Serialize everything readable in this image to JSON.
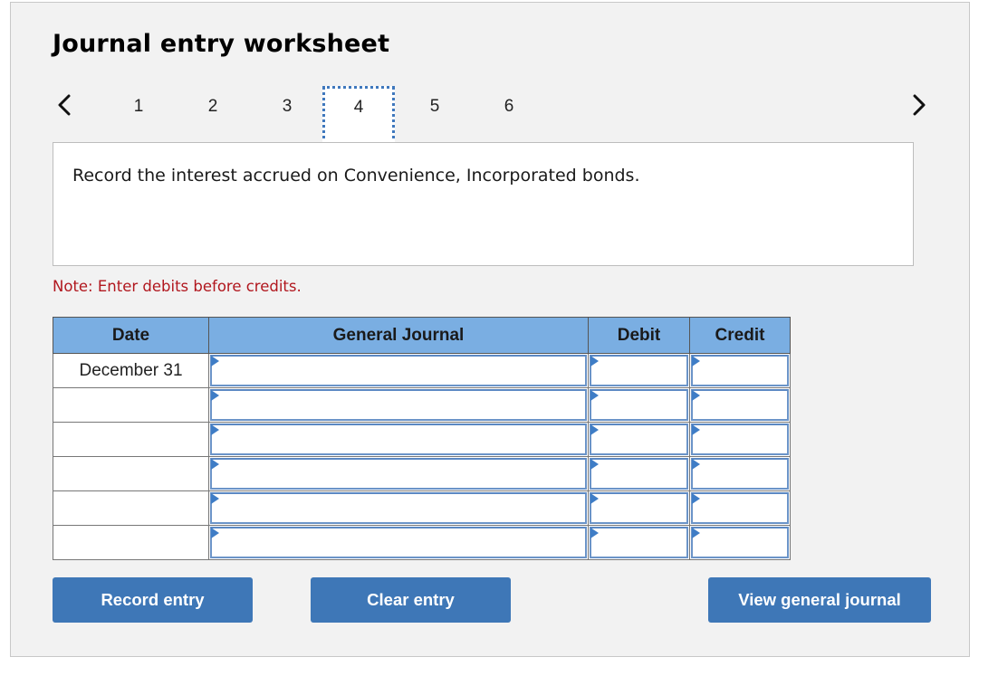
{
  "worksheet": {
    "title": "Journal entry worksheet",
    "nav": {
      "prev_icon": "chevron-left-icon",
      "next_icon": "chevron-right-icon",
      "steps": [
        "1",
        "2",
        "3",
        "4",
        "5",
        "6"
      ],
      "active_step": "4"
    },
    "prompt": "Record the interest accrued on Convenience, Incorporated bonds.",
    "note": "Note: Enter debits before credits.",
    "table": {
      "headers": {
        "date": "Date",
        "general_journal": "General Journal",
        "debit": "Debit",
        "credit": "Credit"
      },
      "rows": [
        {
          "date": "December 31",
          "account": "",
          "debit": "",
          "credit": ""
        },
        {
          "date": "",
          "account": "",
          "debit": "",
          "credit": ""
        },
        {
          "date": "",
          "account": "",
          "debit": "",
          "credit": ""
        },
        {
          "date": "",
          "account": "",
          "debit": "",
          "credit": ""
        },
        {
          "date": "",
          "account": "",
          "debit": "",
          "credit": ""
        },
        {
          "date": "",
          "account": "",
          "debit": "",
          "credit": ""
        }
      ]
    },
    "buttons": {
      "record": "Record entry",
      "clear": "Clear entry",
      "view": "View general journal"
    },
    "colors": {
      "header_bg": "#7aaee2",
      "button_bg": "#3e77b7",
      "note_text": "#b1171e",
      "active_step_border": "#3f78bd"
    }
  }
}
